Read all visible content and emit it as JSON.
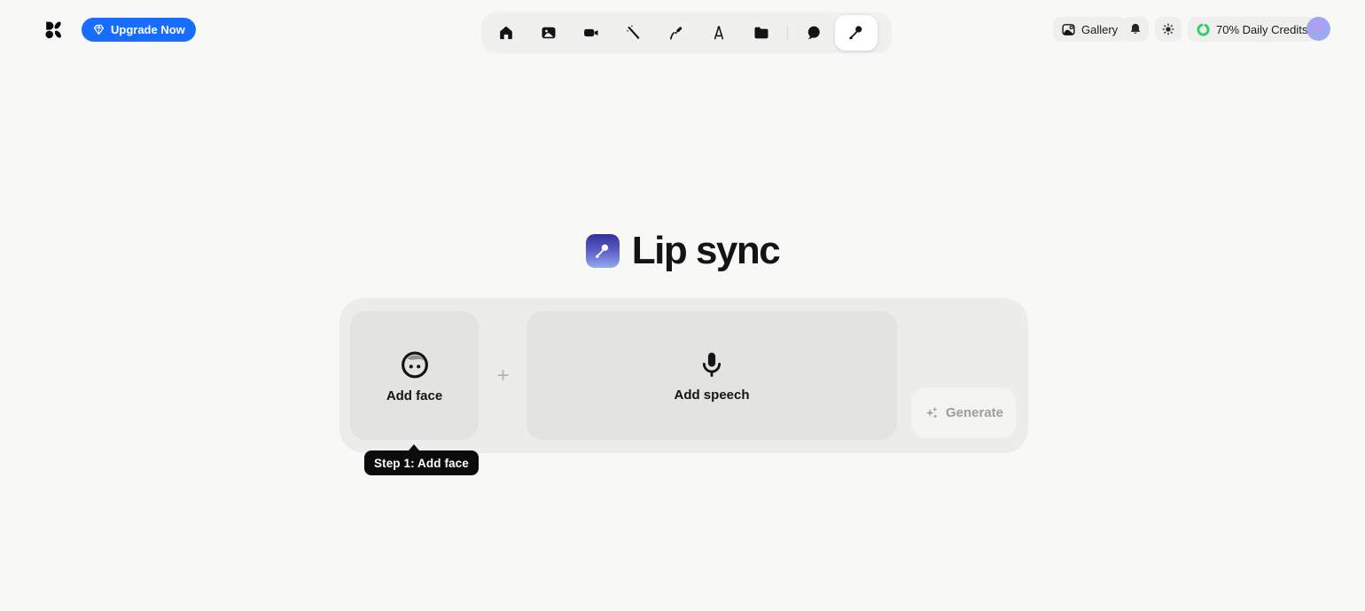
{
  "header": {
    "logo_icon": "krea-logo",
    "upgrade": {
      "label": "Upgrade Now",
      "icon": "gem-icon",
      "bg_color": "#186cff"
    },
    "nav_tabs": [
      {
        "id": "home",
        "icon": "home-icon",
        "active": false
      },
      {
        "id": "image",
        "icon": "image-icon",
        "active": false
      },
      {
        "id": "video",
        "icon": "video-camera-icon",
        "active": false
      },
      {
        "id": "enhance",
        "icon": "magic-wand-icon",
        "active": false
      },
      {
        "id": "edit",
        "icon": "pen-icon",
        "active": false
      },
      {
        "id": "realtime",
        "icon": "drafting-compass-icon",
        "active": false
      },
      {
        "id": "assets",
        "icon": "folder-icon",
        "active": false
      },
      {
        "id": "chat",
        "icon": "chat-bubble-icon",
        "active": false
      },
      {
        "id": "lip-sync",
        "icon": "microphone-icon",
        "active": true
      }
    ],
    "gallery": {
      "label": "Gallery",
      "icon": "gallery-icon"
    },
    "notifications_icon": "bell-icon",
    "theme_icon": "sun-icon",
    "credits": {
      "label": "70% Daily Credits",
      "icon": "progress-ring-icon",
      "ring_color": "#2fcf63"
    },
    "avatar_icon": "user-avatar"
  },
  "main": {
    "title": "Lip sync",
    "title_icon": "lip-sync-gradient-icon",
    "composer": {
      "add_face": {
        "label": "Add face",
        "icon": "face-icon"
      },
      "plus": "+",
      "add_speech": {
        "label": "Add speech",
        "icon": "microphone-icon"
      },
      "generate": {
        "label": "Generate",
        "icon": "sparkles-icon",
        "enabled": false
      }
    },
    "tooltip": {
      "text": "Step 1: Add face"
    }
  }
}
